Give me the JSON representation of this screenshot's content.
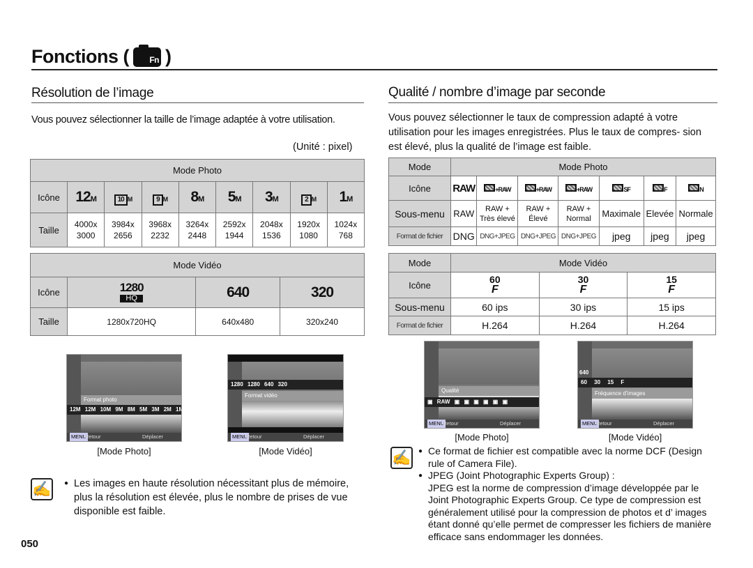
{
  "header": {
    "title": "Fonctions (",
    "title_end": ")",
    "icon_label": "Fn",
    "icon": "camera-fn-icon"
  },
  "left": {
    "heading": "Résolution de l’image",
    "intro": "Vous pouvez sélectionner la taille de l’image adaptée à votre utilisation.",
    "unit": "(Unité : pixel)",
    "photo_table": {
      "title": "Mode Photo",
      "row_icon": "Icône",
      "row_size": "Taille",
      "icons": [
        "12",
        "10",
        "9",
        "8",
        "5",
        "3",
        "2",
        "1"
      ],
      "sizes": [
        [
          "4000x",
          "3000"
        ],
        [
          "3984x",
          "2656"
        ],
        [
          "3968x",
          "2232"
        ],
        [
          "3264x",
          "2448"
        ],
        [
          "2592x",
          "1944"
        ],
        [
          "2048x",
          "1536"
        ],
        [
          "1920x",
          "1080"
        ],
        [
          "1024x",
          "768"
        ]
      ]
    },
    "video_table": {
      "title": "Mode Vidéo",
      "row_icon": "Icône",
      "row_size": "Taille",
      "icons": [
        {
          "main": "1280",
          "sub": "HQ"
        },
        {
          "main": "640"
        },
        {
          "main": "320"
        }
      ],
      "sizes": [
        "1280x720HQ",
        "640x480",
        "320x240"
      ]
    },
    "screens": [
      {
        "caption": "[Mode Photo]",
        "menu": "Format photo",
        "bar": "12M 12M 10M 9M 8M 5M 3M 2M 1M",
        "back": "Retour",
        "move": "Déplacer"
      },
      {
        "caption": "[Mode Vidéo]",
        "menu": "Format vidéo",
        "bar": "1280 1280 640 320",
        "back": "Retour",
        "move": "Déplacer"
      }
    ],
    "note": "Les images en haute résolution nécessitant plus de mémoire, plus la résolution est élevée, plus le nombre de prises de vue disponible est faible."
  },
  "right": {
    "heading": "Qualité / nombre d’image par seconde",
    "intro": "Vous pouvez sélectionner le taux de compression adapté à votre utilisation pour les images enregistrées. Plus le taux de compres- sion est élevé, plus la qualité de l’image est faible.",
    "photo_table": {
      "mode": "Mode",
      "title": "Mode Photo",
      "row_icon": "Icône",
      "row_sub": "Sous-menu",
      "row_fmt": "Format de fichier",
      "icons": [
        "RAW",
        "+RAW",
        "+RAW",
        "+RAW",
        "SF",
        "F",
        "N"
      ],
      "sub": [
        [
          "RAW"
        ],
        [
          "RAW +",
          "Très élevé"
        ],
        [
          "RAW +",
          "Élevé"
        ],
        [
          "RAW +",
          "Normal"
        ],
        [
          "Maximale"
        ],
        [
          "Elevée"
        ],
        [
          "Normale"
        ]
      ],
      "fmt": [
        "DNG",
        "DNG+JPEG",
        "DNG+JPEG",
        "DNG+JPEG",
        "jpeg",
        "jpeg",
        "jpeg"
      ]
    },
    "video_table": {
      "mode": "Mode",
      "title": "Mode Vidéo",
      "row_icon": "Icône",
      "row_sub": "Sous-menu",
      "row_fmt": "Format de fichier",
      "icons": [
        "60",
        "30",
        "15"
      ],
      "sub": [
        "60 ips",
        "30 ips",
        "15 ips"
      ],
      "fmt": [
        "H.264",
        "H.264",
        "H.264"
      ]
    },
    "screens": [
      {
        "caption": "[Mode Photo]",
        "menu": "Qualité",
        "bar": "▣ RAW ▣ ▣ ▣ ▣ ▣ ▣",
        "back": "Retour",
        "move": "Déplacer"
      },
      {
        "caption": "[Mode Vidéo]",
        "menu": "Fréquence d’images",
        "bar": "60 30 15 F",
        "side_label": "640",
        "back": "Retour",
        "move": "Déplacer"
      }
    ],
    "notes": [
      "Ce format de fichier est compatible avec la norme DCF (Design rule of Camera File).",
      "JPEG (Joint Photographic Experts Group) :"
    ],
    "jpeg_text": "JPEG est la norme de compression d’image développée par le Joint Photographic Experts Group. Ce type de compression est généralement utilisé pour la compression de photos et d’ images étant donné qu’elle permet de compresser les fichiers de manière efficace sans endommager les données."
  },
  "page_number": "050"
}
